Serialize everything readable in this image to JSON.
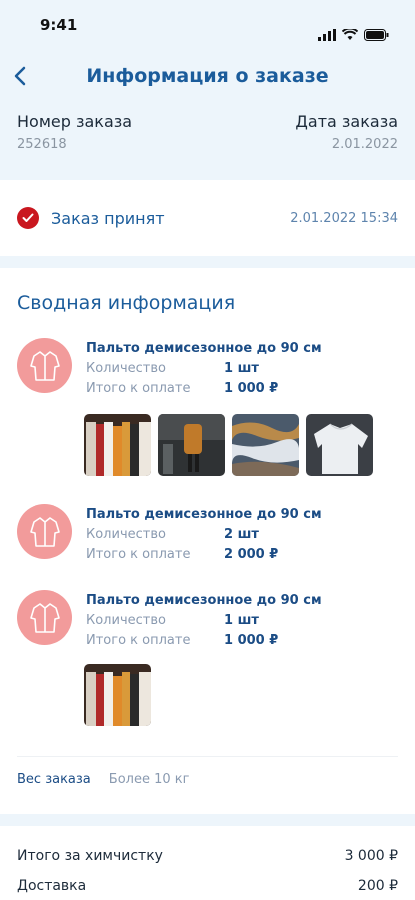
{
  "status_bar": {
    "time": "9:41"
  },
  "nav": {
    "title": "Информация о заказе"
  },
  "order": {
    "number_label": "Номер заказа",
    "number_value": "252618",
    "date_label": "Дата заказа",
    "date_value": "2.01.2022"
  },
  "status": {
    "text": "Заказ принят",
    "time": "2.01.2022 15:34"
  },
  "summary": {
    "title": "Сводная информация",
    "qty_label": "Количество",
    "pay_label": "Итого к оплате",
    "items": [
      {
        "name": "Пальто демисезонное до 90 см",
        "qty": "1 шт",
        "total": "1 000 ₽"
      },
      {
        "name": "Пальто демисезонное до 90 см",
        "qty": "2 шт",
        "total": "2 000 ₽"
      },
      {
        "name": "Пальто демисезонное до 90 см",
        "qty": "1 шт",
        "total": "1 000 ₽"
      }
    ],
    "weight_label": "Вес заказа",
    "weight_value": "Более 10 кг"
  },
  "totals": [
    {
      "label": "Итого за химчистку",
      "value": "3 000 ₽"
    },
    {
      "label": "Доставка",
      "value": "200 ₽"
    }
  ],
  "colors": {
    "accent": "#1b5c9b",
    "status_ok": "#c9171f",
    "icon_bg": "#f29b9b"
  },
  "icons": [
    "back-arrow-icon",
    "check-icon",
    "coat-icon"
  ]
}
